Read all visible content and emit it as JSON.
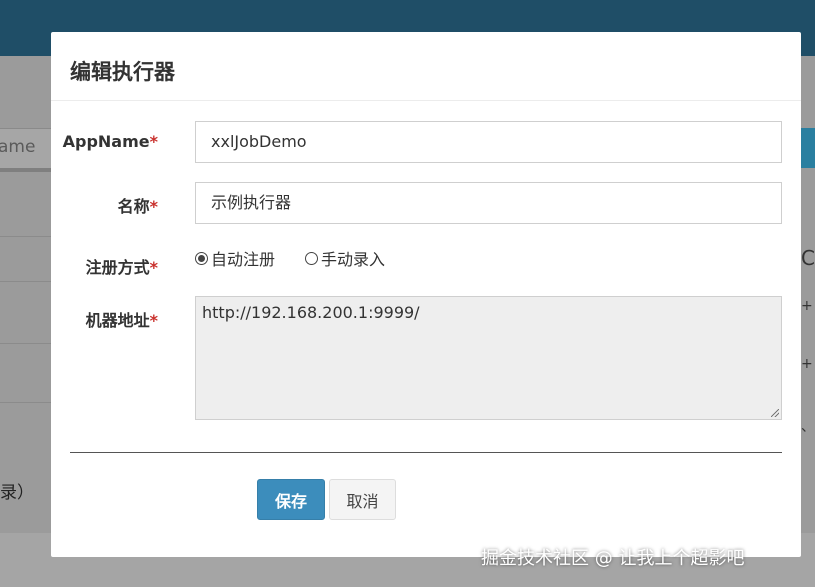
{
  "background": {
    "input_partial_text": "ame",
    "left_partial_text": "录）",
    "right_glyphs": [
      "C",
      "+",
      "+",
      "、"
    ]
  },
  "modal": {
    "title": "编辑执行器",
    "fields": {
      "appname": {
        "label": "AppName",
        "required_mark": "*",
        "value": "xxlJobDemo"
      },
      "name": {
        "label": "名称",
        "required_mark": "*",
        "value": "示例执行器"
      },
      "register_type": {
        "label": "注册方式",
        "required_mark": "*",
        "options": [
          {
            "label": "自动注册",
            "checked": true
          },
          {
            "label": "手动录入",
            "checked": false
          }
        ]
      },
      "address": {
        "label": "机器地址",
        "required_mark": "*",
        "value": "http://192.168.200.1:9999/"
      }
    },
    "buttons": {
      "save": "保存",
      "cancel": "取消"
    }
  },
  "watermark": "掘金技术社区 @ 让我上个超影吧",
  "colors": {
    "topbar": "#1f4e67",
    "primary_button": "#3c8dbc",
    "required": "#c9302c",
    "textarea_bg": "#eeeeee"
  }
}
